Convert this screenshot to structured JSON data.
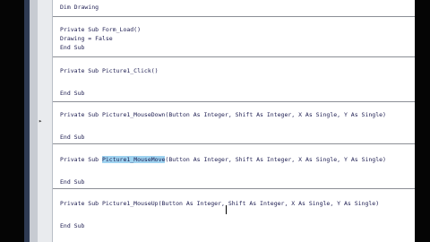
{
  "code_lines": {
    "l0": "Dim Drawing",
    "l1": "Private Sub Form_Load()",
    "l2": "Drawing = False",
    "l3": "End Sub",
    "l4": "Private Sub Picture1_Click()",
    "l5": "End Sub",
    "l6": "Private Sub Picture1_MouseDown(Button As Integer, Shift As Integer, X As Single, Y As Single)",
    "l7": "End Sub",
    "l8a": "Private Sub ",
    "l8b": "Picture1_MouseMove",
    "l8c": "(Button As Integer, Shift As Integer, X As Single, Y As Single)",
    "l9": "End Sub",
    "l10": "Private Sub Picture1_MouseUp(Button As Integer, Shift As Integer, X As Single, Y As Single)",
    "l11": "End Sub"
  },
  "colors": {
    "keyword_text": "#1c1c50",
    "selection_highlight": "#9fd3f0",
    "editor_background": "#ffffff"
  },
  "icons": {
    "split_marker": "split-marker-icon",
    "text_cursor": "ibeam-cursor-icon"
  }
}
